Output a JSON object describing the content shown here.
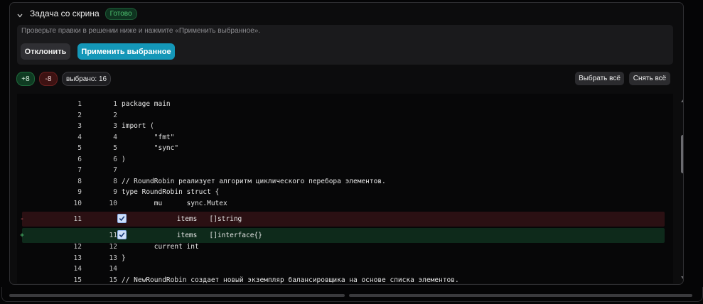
{
  "task": {
    "title": "Задача со скрина",
    "status": "Готово",
    "notice": "Проверьте правки в решении ниже и нажмите «Применить выбранное».",
    "reject_label": "Отклонить",
    "apply_label": "Применить выбранное"
  },
  "stats": {
    "added": "+8",
    "removed": "-8",
    "selected": "выбрано: 16"
  },
  "toolbar": {
    "select_all": "Выбрать всё",
    "clear_all": "Снять всё"
  },
  "diff": [
    {
      "type": "ctx",
      "old": "1",
      "new": "1",
      "text": "package main"
    },
    {
      "type": "ctx",
      "old": "2",
      "new": "2",
      "text": ""
    },
    {
      "type": "ctx",
      "old": "3",
      "new": "3",
      "text": "import ("
    },
    {
      "type": "ctx",
      "old": "4",
      "new": "4",
      "text": "        \"fmt\""
    },
    {
      "type": "ctx",
      "old": "5",
      "new": "5",
      "text": "        \"sync\""
    },
    {
      "type": "ctx",
      "old": "6",
      "new": "6",
      "text": ")"
    },
    {
      "type": "ctx",
      "old": "7",
      "new": "7",
      "text": ""
    },
    {
      "type": "ctx",
      "old": "8",
      "new": "8",
      "text": "// RoundRobin реализует алгоритм циклического перебора элементов."
    },
    {
      "type": "ctx",
      "old": "9",
      "new": "9",
      "text": "type RoundRobin struct {"
    },
    {
      "type": "ctx",
      "old": "10",
      "new": "10",
      "text": "        mu      sync.Mutex"
    },
    {
      "type": "del",
      "marker": "-",
      "old": "11",
      "new": "",
      "text": "        items   []string",
      "checked": true
    },
    {
      "type": "add",
      "marker": "+",
      "old": "",
      "new": "11",
      "text": "        items   []interface{}",
      "checked": true
    },
    {
      "type": "ctx",
      "old": "12",
      "new": "12",
      "text": "        current int"
    },
    {
      "type": "ctx",
      "old": "13",
      "new": "13",
      "text": "}"
    },
    {
      "type": "ctx",
      "old": "14",
      "new": "14",
      "text": ""
    },
    {
      "type": "ctx",
      "old": "15",
      "new": "15",
      "text": "// NewRoundRobin создает новый экземпляр балансировщика на основе списка элементов."
    }
  ],
  "colors": {
    "accent": "#1497b8",
    "added_bg": "#0e2a1b",
    "removed_bg": "#2b1013",
    "ready_badge": "#4ec16f"
  }
}
